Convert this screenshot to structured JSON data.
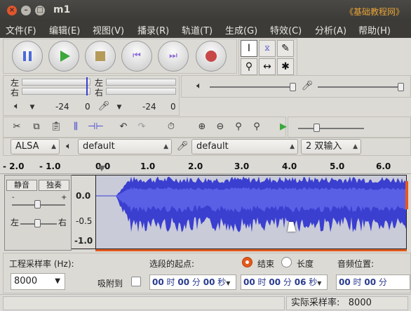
{
  "window": {
    "title": "m1",
    "watermark": "《基础教程网》"
  },
  "menu": [
    "文件(F)",
    "编辑(E)",
    "视图(V)",
    "播录(R)",
    "轨道(T)",
    "生成(G)",
    "特效(C)",
    "分析(A)",
    "帮助(H)"
  ],
  "meter": {
    "left_label": "左",
    "right_label": "右",
    "play_db": "-24",
    "play_zero": "0",
    "rec_db": "-24",
    "rec_zero": "0"
  },
  "devices": {
    "host": "ALSA",
    "playback": "default",
    "recording": "default",
    "channels": "2 双输入"
  },
  "ruler": {
    "ticks": [
      "- 2.0",
      "- 1.0",
      "0.0",
      "1.0",
      "2.0",
      "3.0",
      "4.0",
      "5.0",
      "6.0"
    ]
  },
  "track": {
    "mute": "静音",
    "solo": "独奏",
    "pan_left": "左",
    "pan_right": "右",
    "gain_minus": "-",
    "gain_plus": "+",
    "y_labels": [
      "0.0",
      "-0.5",
      "-1.0"
    ]
  },
  "selection": {
    "rate_label": "工程采样率 (Hz):",
    "rate_value": "8000",
    "snap_label": "吸附到",
    "start_label": "选段的起点:",
    "end_label": "结束",
    "length_label": "长度",
    "position_label": "音频位置:",
    "start_time": {
      "h": "00",
      "h_unit": "时",
      "m": "00",
      "m_unit": "分",
      "s": "00",
      "s_unit": "秒"
    },
    "end_time": {
      "h": "00",
      "h_unit": "时",
      "m": "00",
      "m_unit": "分",
      "s": "06",
      "s_unit": "秒"
    },
    "pos_time": {
      "h": "00",
      "h_unit": "时",
      "m": "00",
      "m_unit": "分"
    }
  },
  "status": {
    "actual_rate": "实际采样率:   8000"
  },
  "colors": {
    "waveform": "#3a3fd0",
    "wave_bg": "#c9cbd9",
    "titlebar": "#3c3b37",
    "accent_orange": "#e4591c"
  },
  "icons": {
    "pause": "pause-icon",
    "play": "play-icon",
    "stop": "stop-icon",
    "skip_start": "skip-start-icon",
    "skip_end": "skip-end-icon",
    "record": "record-icon"
  }
}
